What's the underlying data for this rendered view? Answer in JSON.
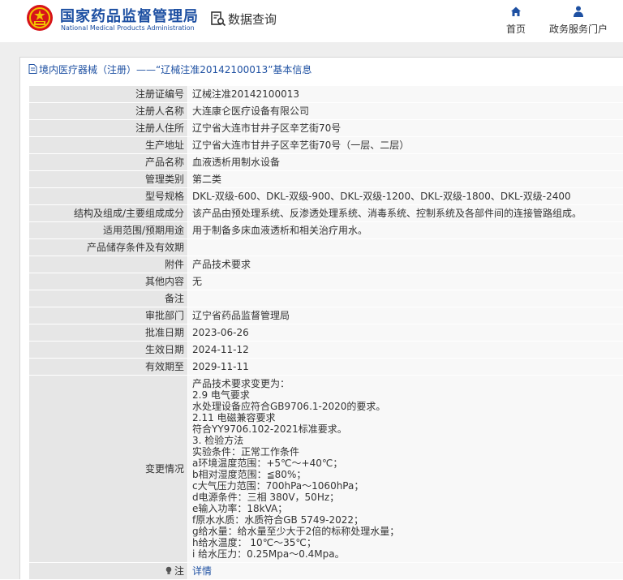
{
  "header": {
    "org_cn": "国家药品监督管理局",
    "org_en": "National Medical Products Administration",
    "data_query": "数据查询",
    "nav": {
      "home": "首页",
      "gov": "政务服务门户"
    }
  },
  "breadcrumb": "境内医疗器械（注册）——“辽械注准20142100013”基本信息",
  "colors": {
    "brand": "#1e50a2",
    "label_bg": "#e6e6e6",
    "value_bg": "#f8f8f8",
    "band": "#eeeeee"
  },
  "rows": [
    {
      "label": "注册证编号",
      "value": "辽械注准20142100013"
    },
    {
      "label": "注册人名称",
      "value": "大连康仑医疗设备有限公司"
    },
    {
      "label": "注册人住所",
      "value": "辽宁省大连市甘井子区辛艺街70号"
    },
    {
      "label": "生产地址",
      "value": "辽宁省大连市甘井子区辛艺街70号（一层、二层）"
    },
    {
      "label": "产品名称",
      "value": "血液透析用制水设备"
    },
    {
      "label": "管理类别",
      "value": "第二类"
    },
    {
      "label": "型号规格",
      "value": "DKL-双级-600、DKL-双级-900、DKL-双级-1200、DKL-双级-1800、DKL-双级-2400"
    },
    {
      "label": "结构及组成/主要组成成分",
      "value": "该产品由预处理系统、反渗透处理系统、消毒系统、控制系统及各部件间的连接管路组成。"
    },
    {
      "label": "适用范围/预期用途",
      "value": "用于制备多床血液透析和相关治疗用水。"
    },
    {
      "label": "产品储存条件及有效期",
      "value": ""
    },
    {
      "label": "附件",
      "value": "产品技术要求"
    },
    {
      "label": "其他内容",
      "value": "无"
    },
    {
      "label": "备注",
      "value": ""
    },
    {
      "label": "审批部门",
      "value": "辽宁省药品监督管理局"
    },
    {
      "label": "批准日期",
      "value": "2023-06-26"
    },
    {
      "label": "生效日期",
      "value": "2024-11-12"
    },
    {
      "label": "有效期至",
      "value": "2029-11-11"
    }
  ],
  "change": {
    "label": "变更情况",
    "lines": [
      "产品技术要求变更为：",
      "2.9 电气要求",
      "水处理设备应符合GB9706.1-2020的要求。",
      "2.11 电磁兼容要求",
      "符合YY9706.102-2021标准要求。",
      "3. 检验方法",
      "实验条件：正常工作条件",
      "a环境温度范围：+5℃～+40℃；",
      "b相对湿度范围：≦80%；",
      "c大气压力范围：700hPa～1060hPa；",
      "d电源条件：三相 380V，50Hz；",
      "e输入功率：18kVA；",
      "f原水水质：水质符合GB 5749-2022；",
      "g给水量：给水量至少大于2倍的标称处理水量；",
      "h给水温度： 10℃～35℃；",
      "i 给水压力：0.25Mpa～0.4Mpa。"
    ]
  },
  "note": {
    "label": "注",
    "link": "详情"
  }
}
